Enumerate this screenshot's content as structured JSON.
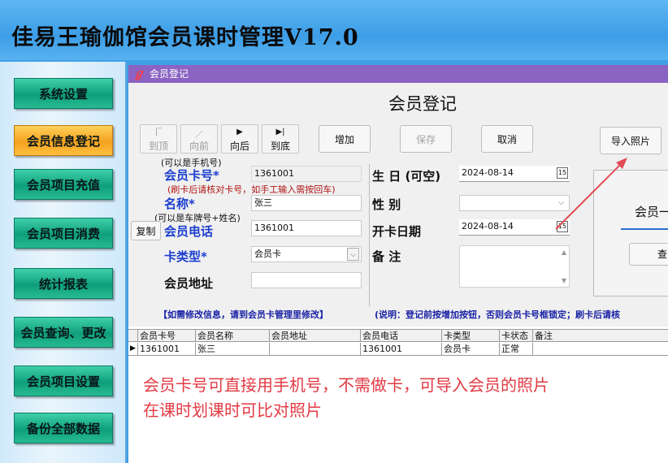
{
  "app": {
    "title": "佳易王瑜伽馆会员课时管理V17.0"
  },
  "sidebar": {
    "items": [
      {
        "label": "系统设置"
      },
      {
        "label": "会员信息登记",
        "active": true
      },
      {
        "label": "会员项目充值"
      },
      {
        "label": "会员项目消费"
      },
      {
        "label": "统计报表"
      },
      {
        "label": "会员查询、更改"
      },
      {
        "label": "会员项目设置"
      },
      {
        "label": "备份全部数据"
      }
    ]
  },
  "window": {
    "title": "会员登记",
    "icon": "app-logo-icon",
    "heading": "会员登记",
    "nav": {
      "first": {
        "label": "到顶",
        "glyph": "|‾"
      },
      "prev": {
        "label": "向前",
        "glyph": "／"
      },
      "next": {
        "label": "向后",
        "glyph": "▶"
      },
      "last": {
        "label": "到底",
        "glyph": "▶|"
      }
    },
    "actions": {
      "add": "增加",
      "save": "保存",
      "cancel": "取消",
      "import_photo": "导入照片"
    },
    "form": {
      "card_hint": "(可以是手机号)",
      "card_label": "会员卡号",
      "card_value": "1361001",
      "card_note": "(刷卡后请核对卡号，如手工输入需按回车)",
      "name_label": "名称",
      "name_value": "张三",
      "name_hint": "(可以是车牌号+姓名)",
      "copy_button": "复制",
      "phone_label": "会员电话",
      "phone_value": "1361001",
      "card_type_label": "卡类型",
      "card_type_value": "会员卡",
      "address_label": "会员地址",
      "address_value": "",
      "birthday_label": "生 日 (可空)",
      "birthday_value": "2024-08-14",
      "gender_label": "性    别",
      "gender_value": "",
      "open_date_label": "开卡日期",
      "open_date_value": "2024-08-14",
      "remark_label": "备    注",
      "remark_value": "",
      "required_mark": "*"
    },
    "photo": {
      "label": "会员一",
      "query_button": "查"
    },
    "notices": {
      "left": "【如需修改信息，请到会员卡管理里修改】",
      "right": "(说明：登记前按增加按钮，否则会员卡号框锁定；刷卡后请核"
    },
    "table": {
      "columns": [
        "会员卡号",
        "会员名称",
        "会员地址",
        "会员电话",
        "卡类型",
        "卡状态",
        "备注"
      ],
      "rows": [
        [
          "1361001",
          "张三",
          "",
          "1361001",
          "会员卡",
          "正常",
          ""
        ]
      ],
      "row_marker": "▶"
    }
  },
  "annotation": {
    "line1": "会员卡号可直接用手机号，不需做卡，可导入会员的照片",
    "line2": "在课时划课时可比对照片",
    "color": "#e23a44"
  },
  "colors": {
    "nav_green": "#0e9e7c",
    "nav_active": "#f4a21f",
    "titlebar": "#8b63c3",
    "label_blue": "#1c3fcf"
  }
}
